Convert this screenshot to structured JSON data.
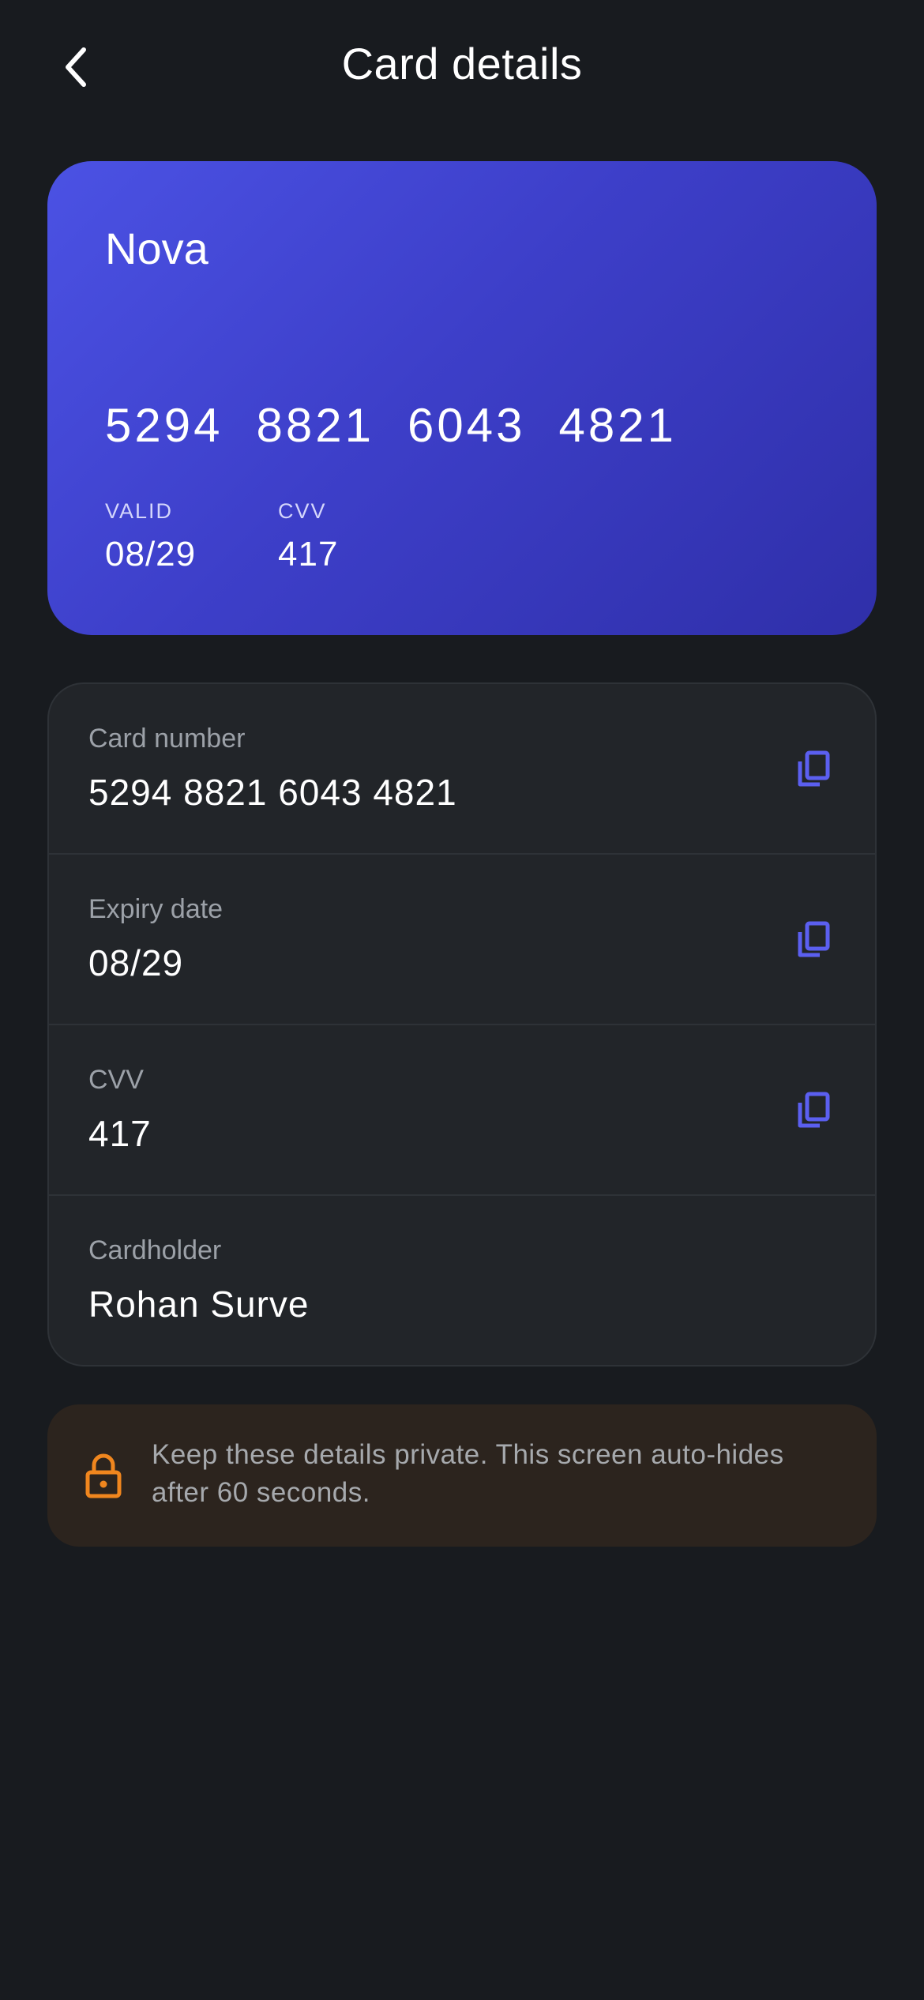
{
  "header": {
    "title": "Card details",
    "back_icon": "chevron-left-icon"
  },
  "card": {
    "brand": "Nova",
    "number_groups": [
      "5294",
      "8821",
      "6043",
      "4821"
    ],
    "valid_label": "VALID",
    "valid_value": "08/29",
    "cvv_label": "CVV",
    "cvv_value": "417",
    "gradient_colors": [
      "#4b52e4",
      "#2f2fa9"
    ]
  },
  "details": {
    "rows": [
      {
        "label": "Card number",
        "value": "5294 8821 6043 4821",
        "copy_icon": "copy-icon"
      },
      {
        "label": "Expiry date",
        "value": "08/29",
        "copy_icon": "copy-icon"
      },
      {
        "label": "CVV",
        "value": "417",
        "copy_icon": "copy-icon"
      },
      {
        "label": "Cardholder",
        "value": "Rohan Surve"
      }
    ]
  },
  "notice": {
    "icon": "lock-icon",
    "text": "Keep these details private. This screen auto-hides after 60 seconds."
  },
  "colors": {
    "background": "#181b1f",
    "panel": "#222529",
    "accent": "#5b5ff0",
    "warning": "#f0861e",
    "notice_bg": "#2c241e"
  }
}
